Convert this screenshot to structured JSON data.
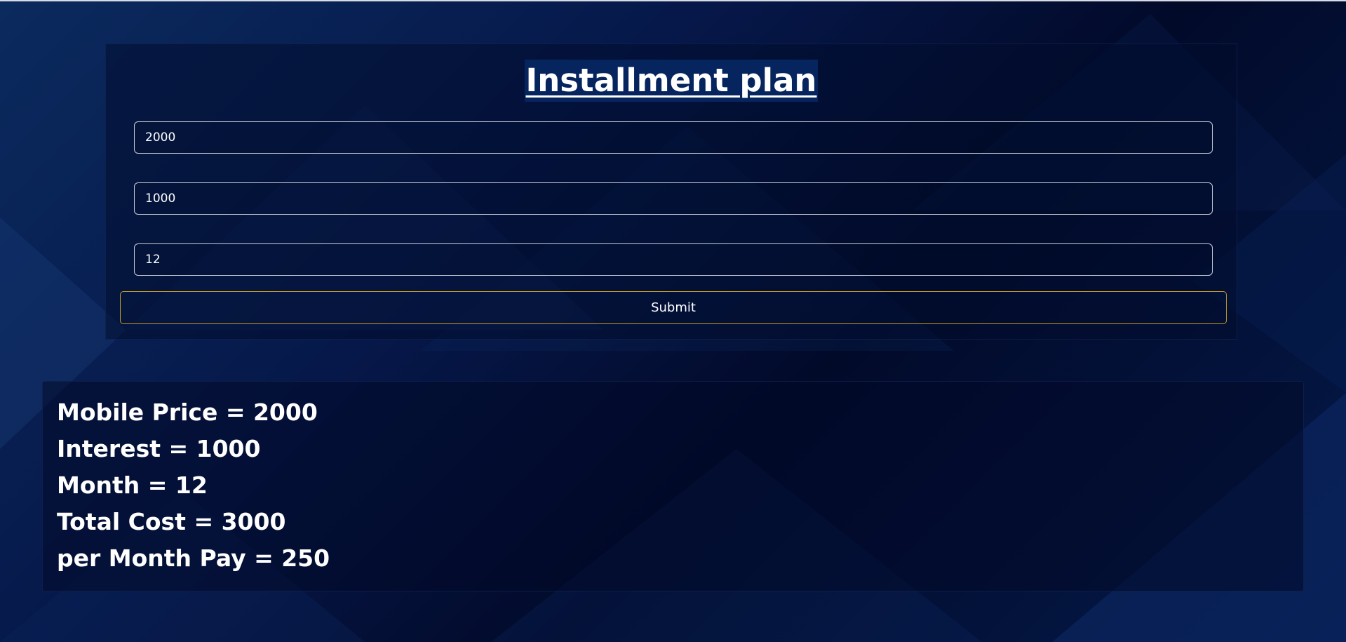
{
  "form": {
    "title": "Installment plan",
    "inputs": [
      {
        "value": "2000"
      },
      {
        "value": "1000"
      },
      {
        "value": "12"
      }
    ],
    "submit_label": "Submit"
  },
  "results": [
    "Mobile Price = 2000",
    "Interest = 1000",
    "Month = 12",
    "Total Cost = 3000",
    "per Month Pay = 250"
  ],
  "colors": {
    "background_dark": "#020a2a",
    "background_blue": "#0b2a5e",
    "title_highlight": "#06255e",
    "submit_border": "#c79a2a",
    "input_border": "#c9ced8"
  }
}
